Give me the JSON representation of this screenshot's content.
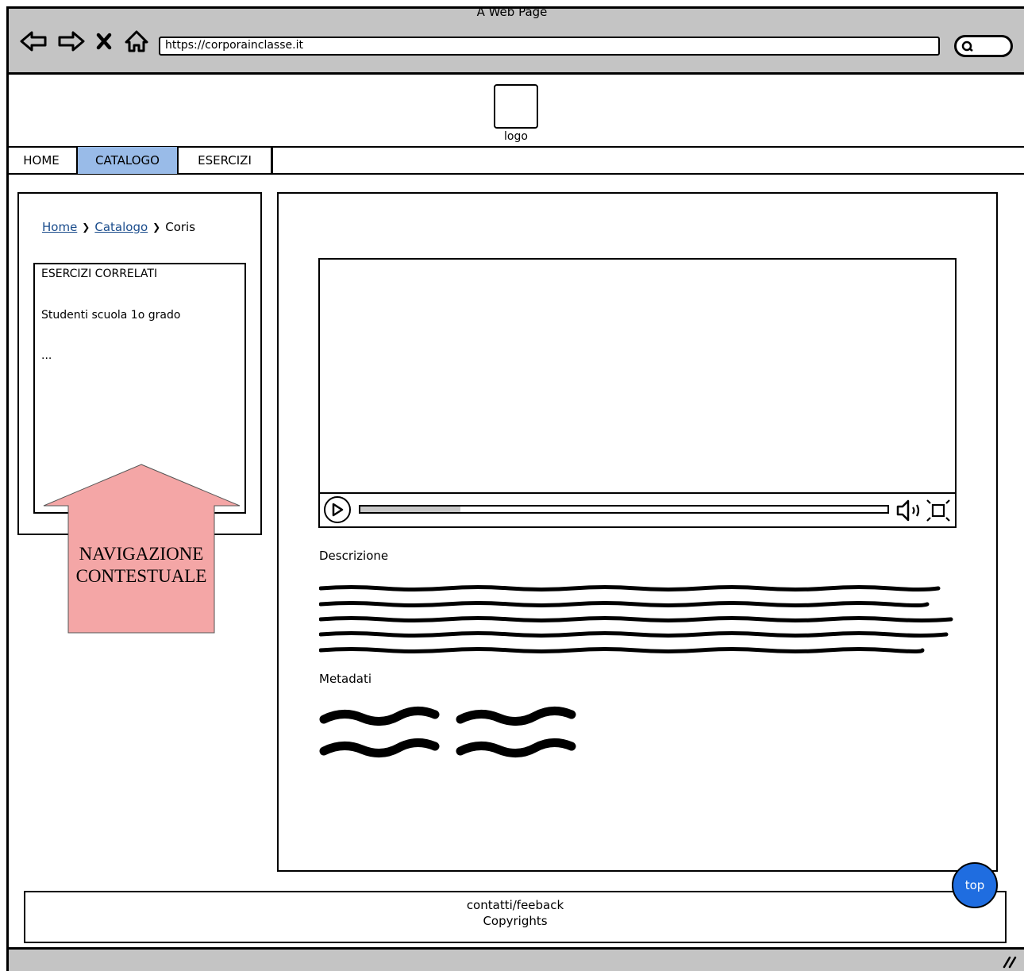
{
  "window": {
    "title": "A Web Page"
  },
  "browser": {
    "url": "https://corporainclasse.it",
    "icons": [
      "back-arrow-icon",
      "forward-arrow-icon",
      "close-x-icon",
      "home-icon",
      "search-icon"
    ]
  },
  "header": {
    "logo_label": "logo"
  },
  "nav": {
    "items": [
      {
        "label": "HOME",
        "active": false
      },
      {
        "label": "CATALOGO",
        "active": true
      },
      {
        "label": "ESERCIZI",
        "active": false
      }
    ],
    "active_color": "#99bbe8"
  },
  "breadcrumb": {
    "items": [
      "Home",
      "Catalogo",
      "Coris"
    ]
  },
  "sidebar": {
    "related_title": "ESERCIZI CORRELATI",
    "related_items": [
      "Studenti scuola 1o grado",
      "..."
    ]
  },
  "callout": {
    "text_line1": "NAVIGAZIONE",
    "text_line2": "CONTESTUALE",
    "color": "#f4a6a6"
  },
  "video": {
    "progress": 0.19,
    "icons": [
      "play-icon",
      "volume-icon",
      "fullscreen-icon"
    ]
  },
  "main": {
    "description_label": "Descrizione",
    "metadata_label": "Metadati"
  },
  "footer": {
    "line1": "contatti/feeback",
    "line2": "Copyrights"
  },
  "top_button": {
    "label": "top",
    "color": "#1f6de0"
  }
}
